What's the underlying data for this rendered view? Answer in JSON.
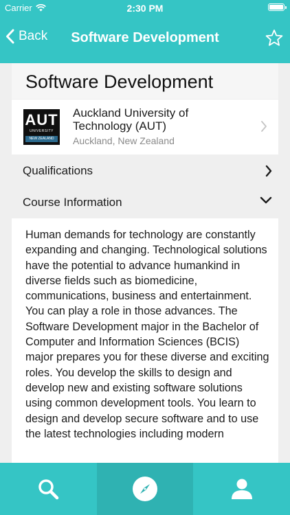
{
  "status_bar": {
    "carrier": "Carrier",
    "time": "2:30 PM"
  },
  "nav": {
    "back_label": "Back",
    "title": "Software Development"
  },
  "course": {
    "heading": "Software Development"
  },
  "university": {
    "logo_text": "AUT",
    "logo_subtext": "UNIVERSITY",
    "logo_strip": "NEW ZEALAND",
    "name": "Auckland University of Technology (AUT)",
    "location": "Auckland, New Zealand"
  },
  "sections": {
    "qualifications": "Qualifications",
    "course_information": "Course Information"
  },
  "description": "Human demands for technology are constantly expanding and changing. Technological solutions have the potential to advance humankind in diverse fields such as biomedicine, communications, business and entertainment. You can play a role in those advances. The Software Development major in the Bachelor of Computer and Information Sciences (BCIS) major prepares you for these diverse and exciting roles.  You develop the skills to design and develop new and existing software solutions using common development tools. You learn to design and develop secure software and to use the latest technologies including modern",
  "tabs": [
    {
      "name": "search",
      "icon": "search-icon"
    },
    {
      "name": "explore",
      "icon": "compass-icon",
      "selected": true
    },
    {
      "name": "profile",
      "icon": "person-icon"
    }
  ],
  "colors": {
    "accent": "#35c5c5",
    "accent_selected": "#2fb2b2",
    "background": "#efefef"
  }
}
